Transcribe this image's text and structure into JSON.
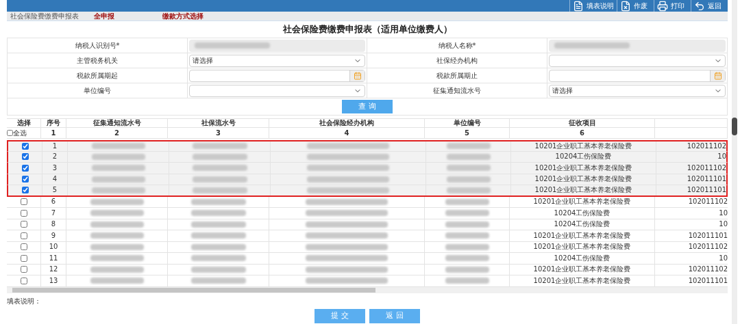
{
  "toolbar": [
    {
      "kind": "doc",
      "label": "填表说明"
    },
    {
      "kind": "void",
      "label": "作废"
    },
    {
      "kind": "print",
      "label": "打印"
    },
    {
      "kind": "back",
      "label": "返回"
    }
  ],
  "breadcrumb": {
    "title": "社会保险费缴费申报表",
    "links": [
      "全申报",
      "缴款方式选择"
    ]
  },
  "form": {
    "title": "社会保险费缴费申报表（适用单位缴费人）",
    "fields": [
      {
        "label": "纳税人识别号*",
        "kind": "readonly"
      },
      {
        "label": "纳税人名称*",
        "kind": "readonly"
      },
      {
        "label": "主管税务机关",
        "kind": "select",
        "value": "请选择"
      },
      {
        "label": "社保经办机构",
        "kind": "select"
      },
      {
        "label": "税款所属期起",
        "kind": "date"
      },
      {
        "label": "税款所属期止",
        "kind": "date"
      },
      {
        "label": "单位编号",
        "kind": "select"
      },
      {
        "label": "征集通知流水号",
        "kind": "select",
        "value": "请选择"
      }
    ],
    "query_button": "查 询"
  },
  "table": {
    "columns": [
      "选择",
      "序号",
      "征集通知流水号",
      "社保流水号",
      "社会保险经办机构",
      "单位编号",
      "征收项目"
    ],
    "select_all": {
      "label": "全选",
      "checked": false
    },
    "column_numbers": [
      "1",
      "2",
      "3",
      "4",
      "5",
      "6"
    ],
    "rows": [
      {
        "checked": true,
        "no": "1",
        "item": "10201企业职工基本养老保险费",
        "column_7": "102011102"
      },
      {
        "checked": true,
        "no": "2",
        "item": "10204工伤保险费",
        "column_7": "10"
      },
      {
        "checked": true,
        "no": "3",
        "item": "10201企业职工基本养老保险费",
        "column_7": "102011102"
      },
      {
        "checked": true,
        "no": "4",
        "item": "10201企业职工基本养老保险费",
        "column_7": "102011101"
      },
      {
        "checked": true,
        "no": "5",
        "item": "10201企业职工基本养老保险费",
        "column_7": "102011101"
      },
      {
        "checked": false,
        "no": "6",
        "item": "10201企业职工基本养老保险费",
        "column_7": "102011102"
      },
      {
        "checked": false,
        "no": "7",
        "item": "10204工伤保险费",
        "column_7": "10"
      },
      {
        "checked": false,
        "no": "8",
        "item": "10204工伤保险费",
        "column_7": "10"
      },
      {
        "checked": false,
        "no": "9",
        "item": "10201企业职工基本养老保险费",
        "column_7": "102011101"
      },
      {
        "checked": false,
        "no": "10",
        "item": "10201企业职工基本养老保险费",
        "column_7": "102011102"
      },
      {
        "checked": false,
        "no": "11",
        "item": "10204工伤保险费",
        "column_7": "10"
      },
      {
        "checked": false,
        "no": "12",
        "item": "10201企业职工基本养老保险费",
        "column_7": "102011102"
      },
      {
        "checked": false,
        "no": "13",
        "item": "10201企业职工基本养老保险费",
        "column_7": "102011101"
      }
    ]
  },
  "note": "填表说明：",
  "buttons": [
    "提 交",
    "返 回"
  ]
}
